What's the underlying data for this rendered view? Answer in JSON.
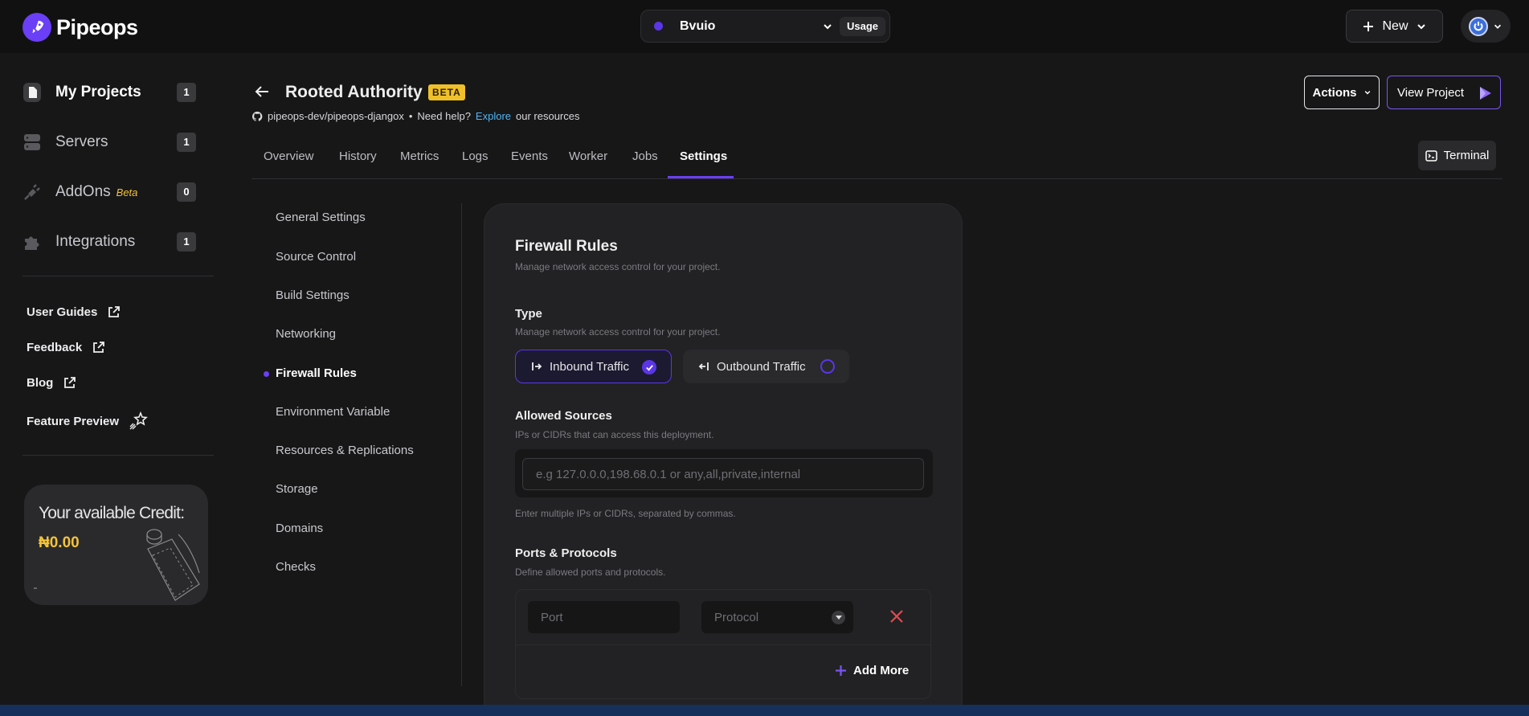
{
  "brand": {
    "name": "Pipeops"
  },
  "project_switcher": {
    "name": "Bvuio",
    "usage_label": "Usage"
  },
  "topbar": {
    "new_label": "New"
  },
  "sidebar": {
    "items": [
      {
        "label": "My Projects",
        "count": "1",
        "active": true
      },
      {
        "label": "Servers",
        "count": "1"
      },
      {
        "label": "AddOns",
        "badge": "Beta",
        "count": "0"
      },
      {
        "label": "Integrations",
        "count": "1"
      }
    ],
    "links": [
      {
        "label": "User Guides"
      },
      {
        "label": "Feedback"
      },
      {
        "label": "Blog"
      },
      {
        "label": "Feature Preview"
      }
    ],
    "credit": {
      "title": "Your available Credit:",
      "amount": "₦0.00"
    }
  },
  "header": {
    "title": "Rooted Authority",
    "badge": "BETA",
    "repo": "pipeops-dev/pipeops-djangox",
    "bullet": "•",
    "help_prefix": "Need help?",
    "help_link": "Explore",
    "help_suffix": "our resources",
    "actions_label": "Actions",
    "view_project_label": "View Project"
  },
  "tabs": [
    "Overview",
    "History",
    "Metrics",
    "Logs",
    "Events",
    "Worker",
    "Jobs",
    "Settings"
  ],
  "active_tab": "Settings",
  "terminal_label": "Terminal",
  "settings_nav": [
    "General Settings",
    "Source Control",
    "Build Settings",
    "Networking",
    "Firewall Rules",
    "Environment Variable",
    "Resources & Replications",
    "Storage",
    "Domains",
    "Checks"
  ],
  "settings_nav_active": "Firewall Rules",
  "firewall": {
    "title": "Firewall Rules",
    "subtitle": "Manage network access control for your project.",
    "type_title": "Type",
    "type_desc": "Manage network access control for your project.",
    "inbound_label": "Inbound Traffic",
    "outbound_label": "Outbound Traffic",
    "selected_type": "Inbound Traffic",
    "sources_title": "Allowed Sources",
    "sources_desc": "IPs or CIDRs that can access this deployment.",
    "sources_placeholder": "e.g 127.0.0.0,198.68.0.1 or any,all,private,internal",
    "sources_value": "",
    "sources_hint": "Enter multiple IPs or CIDRs, separated by commas.",
    "ports_title": "Ports & Protocols",
    "ports_desc": "Define allowed ports and protocols.",
    "port_placeholder": "Port",
    "protocol_placeholder": "Protocol",
    "add_more_label": "Add More"
  },
  "colors": {
    "accent": "#6a3ff5",
    "badge_yellow": "#f0c02a",
    "link_blue": "#51b4f2",
    "danger": "#e5484d"
  }
}
